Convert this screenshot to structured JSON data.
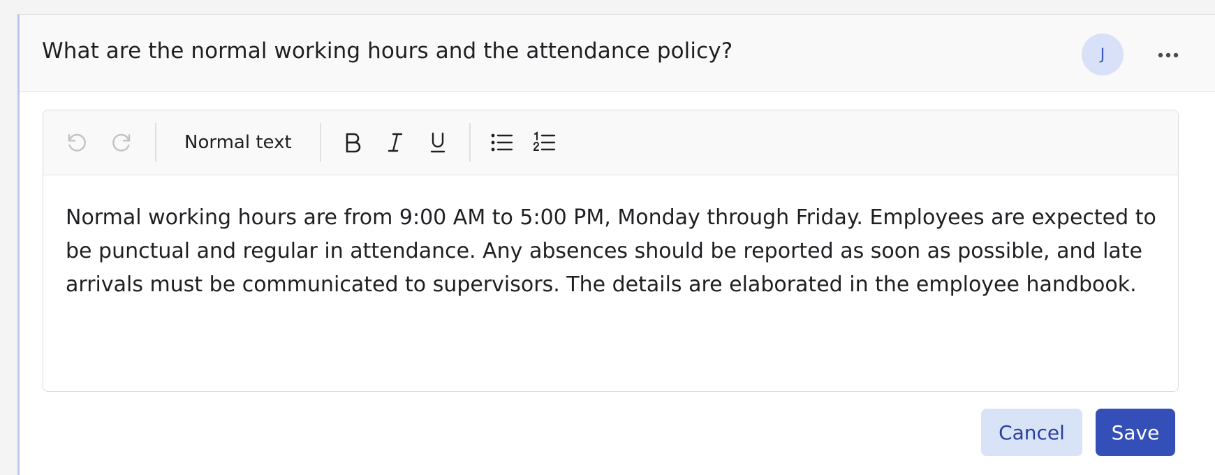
{
  "question": {
    "title": "What are the normal working hours and the attendance policy?"
  },
  "avatar": {
    "initial": "J"
  },
  "toolbar": {
    "text_style": "Normal text",
    "undo_icon": "undo-icon",
    "redo_icon": "redo-icon",
    "bold_icon": "bold-icon",
    "italic_icon": "italic-icon",
    "underline_icon": "underline-icon",
    "bullet_list_icon": "bullet-list-icon",
    "numbered_list_icon": "numbered-list-icon"
  },
  "editor": {
    "body": "Normal working hours are from 9:00 AM to 5:00 PM, Monday through Friday. Employees are expected to be punctual and regular in attendance. Any absences should be reported as soon as possible, and late arrivals must be communicated to supervisors. The details are elaborated in the employee handbook."
  },
  "actions": {
    "cancel_label": "Cancel",
    "save_label": "Save"
  },
  "colors": {
    "accent": "#3450b8",
    "accent_light": "#d9e3f8",
    "avatar_bg": "#d8e1f8",
    "card_left_border": "#b9c6ee"
  }
}
